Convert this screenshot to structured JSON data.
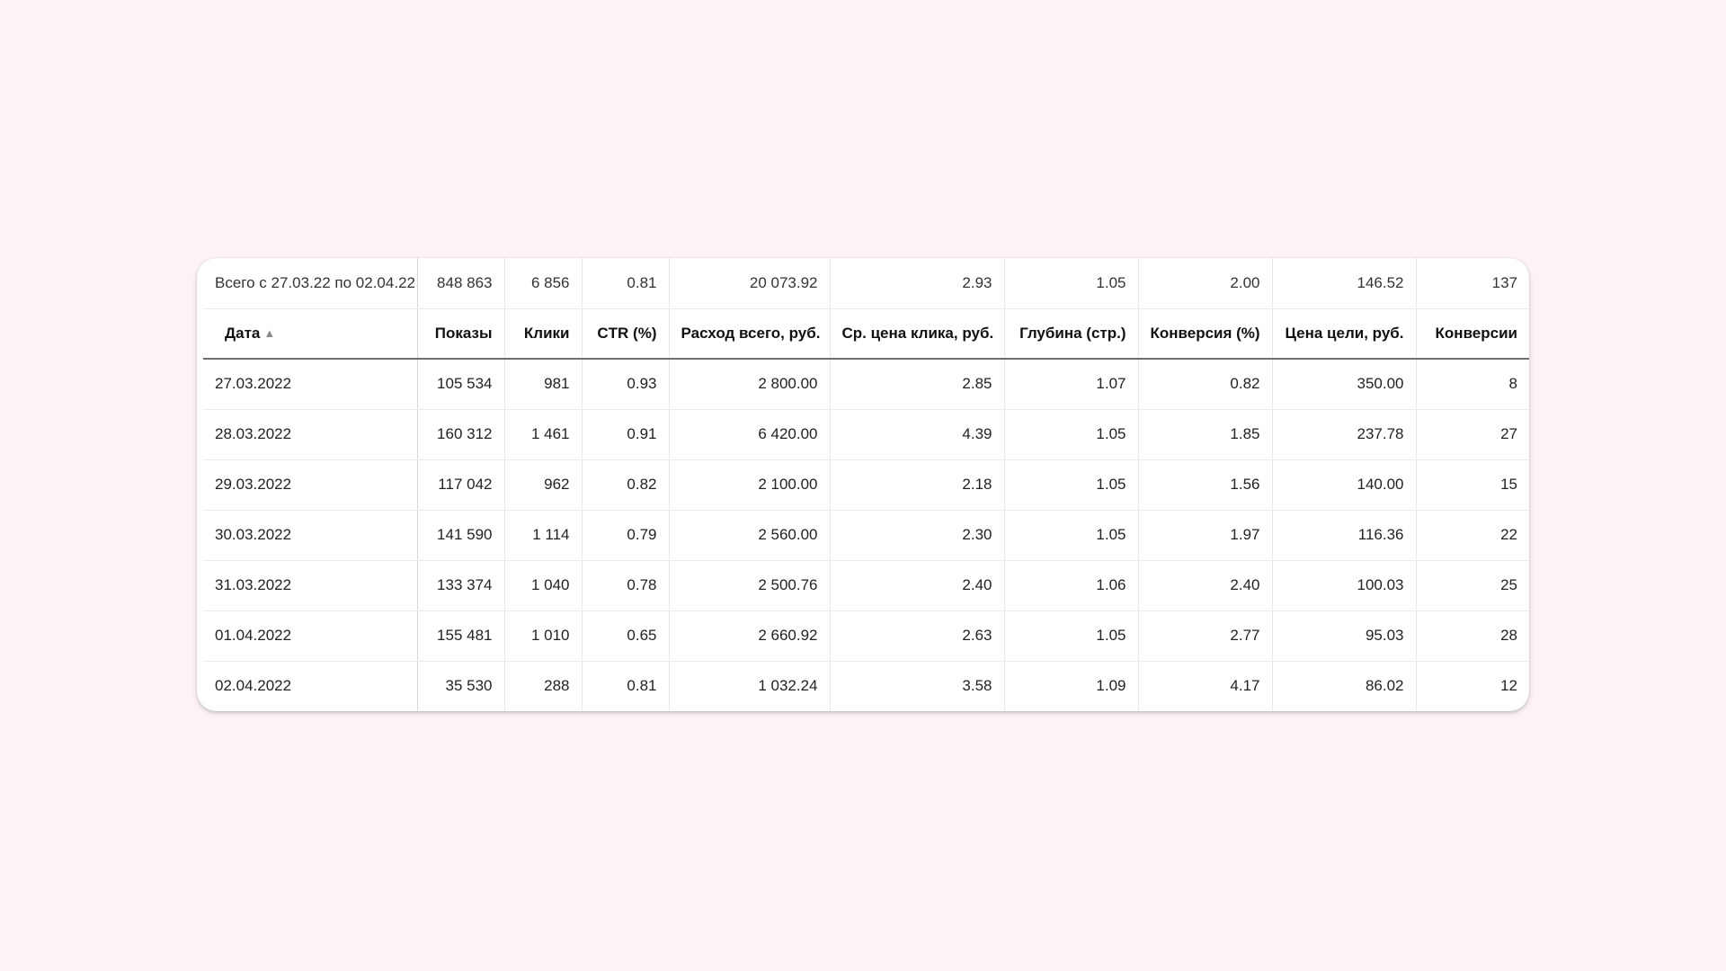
{
  "table": {
    "total": {
      "label": "Всего с 27.03.22 по 02.04.22",
      "values": [
        "848 863",
        "6 856",
        "0.81",
        "20 073.92",
        "2.93",
        "1.05",
        "2.00",
        "146.52",
        "137"
      ]
    },
    "columns": [
      "Дата",
      "Показы",
      "Клики",
      "CTR (%)",
      "Расход всего, руб.",
      "Ср. цена клика, руб.",
      "Глубина (стр.)",
      "Конверсия (%)",
      "Цена цели, руб.",
      "Конверсии"
    ],
    "sort_icon": "triangle-up-icon",
    "rows": [
      [
        "27.03.2022",
        "105 534",
        "981",
        "0.93",
        "2 800.00",
        "2.85",
        "1.07",
        "0.82",
        "350.00",
        "8"
      ],
      [
        "28.03.2022",
        "160 312",
        "1 461",
        "0.91",
        "6 420.00",
        "4.39",
        "1.05",
        "1.85",
        "237.78",
        "27"
      ],
      [
        "29.03.2022",
        "117 042",
        "962",
        "0.82",
        "2 100.00",
        "2.18",
        "1.05",
        "1.56",
        "140.00",
        "15"
      ],
      [
        "30.03.2022",
        "141 590",
        "1 114",
        "0.79",
        "2 560.00",
        "2.30",
        "1.05",
        "1.97",
        "116.36",
        "22"
      ],
      [
        "31.03.2022",
        "133 374",
        "1 040",
        "0.78",
        "2 500.76",
        "2.40",
        "1.06",
        "2.40",
        "100.03",
        "25"
      ],
      [
        "01.04.2022",
        "155 481",
        "1 010",
        "0.65",
        "2 660.92",
        "2.63",
        "1.05",
        "2.77",
        "95.03",
        "28"
      ],
      [
        "02.04.2022",
        "35 530",
        "288",
        "0.81",
        "1 032.24",
        "3.58",
        "1.09",
        "4.17",
        "86.02",
        "12"
      ]
    ]
  },
  "colors": {
    "background": "#fdf3f4",
    "card": "#ffffff",
    "header_rule": "#6e6e6e"
  }
}
